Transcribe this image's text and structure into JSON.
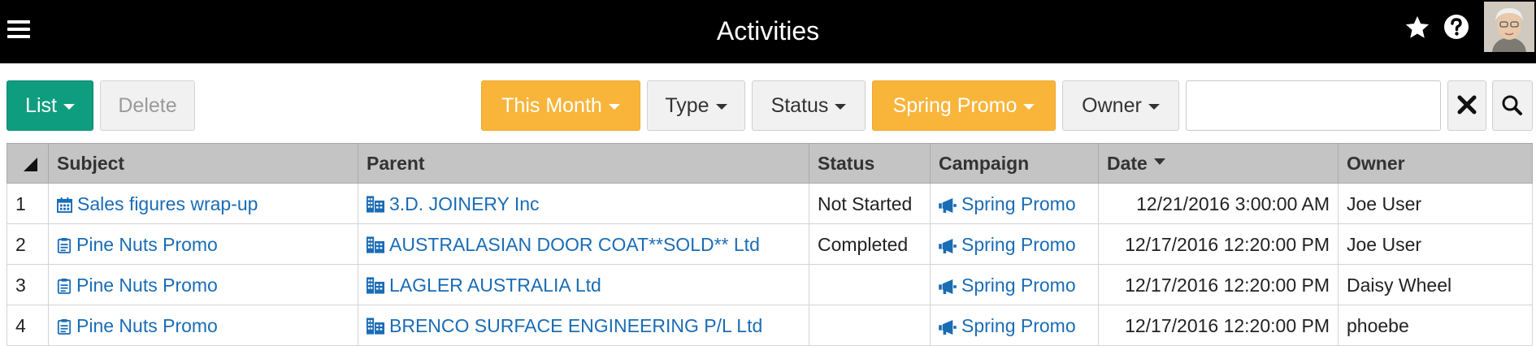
{
  "header": {
    "title": "Activities"
  },
  "toolbar": {
    "list_label": "List",
    "delete_label": "Delete",
    "filters": {
      "date": "This Month",
      "type": "Type",
      "status": "Status",
      "campaign": "Spring Promo",
      "owner": "Owner"
    },
    "search": {
      "value": "",
      "placeholder": ""
    }
  },
  "colors": {
    "topbar": "#000000",
    "accent_green": "#0f9d7f",
    "active_filter": "#f8b53a",
    "link": "#1a6cb5",
    "header_bg": "#c4c4c4"
  },
  "table": {
    "columns": [
      "Subject",
      "Parent",
      "Status",
      "Campaign",
      "Date",
      "Owner"
    ],
    "rows": [
      {
        "num": "1",
        "subject": "Sales figures wrap-up",
        "subject_icon": "calendar-icon",
        "parent": "3.D. JOINERY Inc",
        "status": "Not Started",
        "campaign": "Spring Promo",
        "date": "12/21/2016 3:00:00 AM",
        "owner": "Joe User"
      },
      {
        "num": "2",
        "subject": "Pine Nuts Promo",
        "subject_icon": "clipboard-icon",
        "parent": "AUSTRALASIAN DOOR COAT**SOLD** Ltd",
        "status": "Completed",
        "campaign": "Spring Promo",
        "date": "12/17/2016 12:20:00 PM",
        "owner": "Joe User"
      },
      {
        "num": "3",
        "subject": "Pine Nuts Promo",
        "subject_icon": "clipboard-icon",
        "parent": "LAGLER AUSTRALIA Ltd",
        "status": "",
        "campaign": "Spring Promo",
        "date": "12/17/2016 12:20:00 PM",
        "owner": "Daisy Wheel"
      },
      {
        "num": "4",
        "subject": "Pine Nuts Promo",
        "subject_icon": "clipboard-icon",
        "parent": "BRENCO SURFACE ENGINEERING P/L Ltd",
        "status": "",
        "campaign": "Spring Promo",
        "date": "12/17/2016 12:20:00 PM",
        "owner": "phoebe"
      }
    ]
  }
}
